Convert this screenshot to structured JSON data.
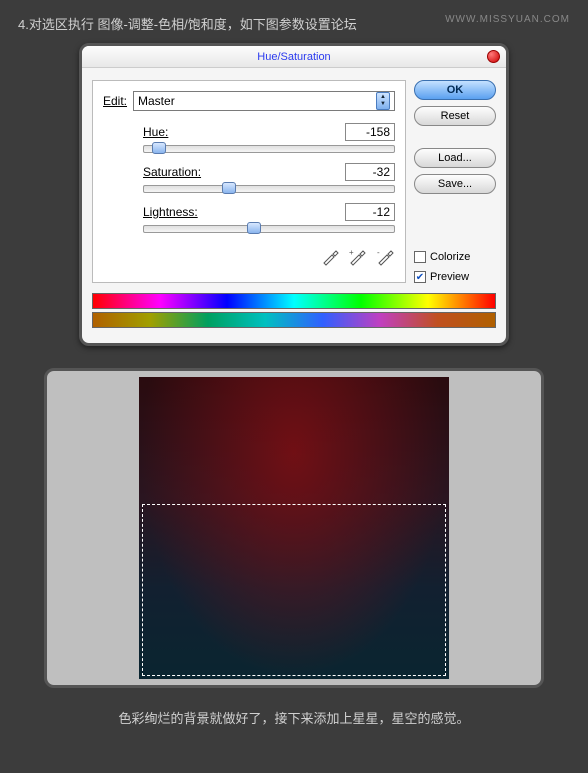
{
  "instruction_top": "4.对选区执行 图像-调整-色相/饱和度，如下图参数设置论坛",
  "watermark": "WWW.MISSYUAN.COM",
  "dialog": {
    "title": "Hue/Saturation",
    "edit_label": "Edit:",
    "edit_value": "Master",
    "sliders": {
      "hue": {
        "label": "Hue:",
        "value": "-158"
      },
      "saturation": {
        "label": "Saturation:",
        "value": "-32"
      },
      "lightness": {
        "label": "Lightness:",
        "value": "-12"
      }
    },
    "buttons": {
      "ok": "OK",
      "reset": "Reset",
      "load": "Load...",
      "save": "Save..."
    },
    "checkboxes": {
      "colorize": "Colorize",
      "preview": "Preview"
    }
  },
  "instruction_bottom": "色彩绚烂的背景就做好了，接下来添加上星星，星空的感觉。",
  "chart_data": {
    "type": "dialog-settings",
    "hue": -158,
    "saturation": -32,
    "lightness": -12,
    "hue_range": [
      -180,
      180
    ],
    "saturation_range": [
      -100,
      100
    ],
    "lightness_range": [
      -100,
      100
    ],
    "colorize": false,
    "preview": true
  }
}
